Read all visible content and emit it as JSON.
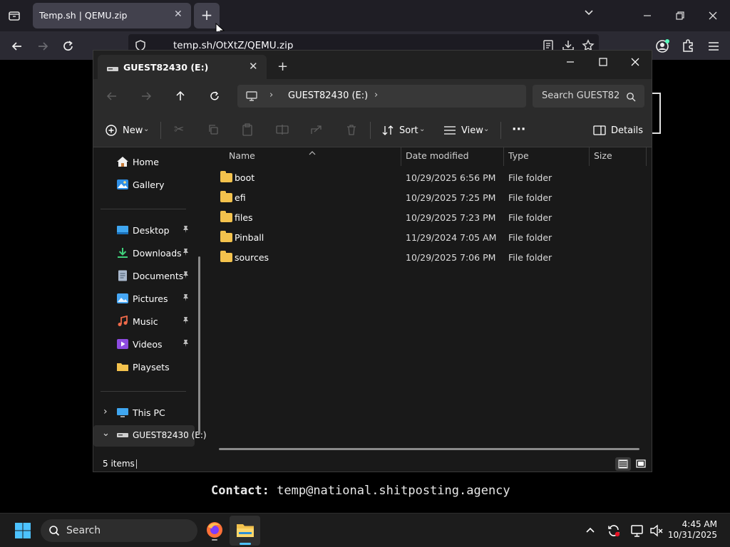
{
  "browser": {
    "tab_title": "Temp.sh | QEMU.zip",
    "tab_close": "✕",
    "new_tab": "+",
    "url": "temp.sh/OtXtZ/QEMU.zip",
    "icons": [
      "tab-list-icon",
      "back-icon",
      "forward-icon",
      "reload-icon",
      "shield-icon",
      "reader-view-icon",
      "download-icon",
      "bookmark-star-icon",
      "account-icon",
      "extensions-icon",
      "menu-icon",
      "chevron-down-icon"
    ]
  },
  "page": {
    "contact_label": "Contact:",
    "contact_value": "temp@national.shitposting.agency"
  },
  "explorer": {
    "tab_title": "GUEST82430 (E:)",
    "tab_close": "✕",
    "add_tab": "+",
    "breadcrumb": "GUEST82430 (E:)",
    "search_placeholder": "Search GUEST82",
    "cmd": {
      "new": "New",
      "sort": "Sort",
      "view": "View",
      "more": "···",
      "details": "Details"
    },
    "nav": {
      "quick": [
        {
          "label": "Home",
          "icon": "home-icon"
        },
        {
          "label": "Gallery",
          "icon": "gallery-icon"
        }
      ],
      "pinned": [
        {
          "label": "Desktop",
          "icon": "desktop-icon"
        },
        {
          "label": "Downloads",
          "icon": "downloads-icon"
        },
        {
          "label": "Documents",
          "icon": "documents-icon"
        },
        {
          "label": "Pictures",
          "icon": "pictures-icon"
        },
        {
          "label": "Music",
          "icon": "music-icon"
        },
        {
          "label": "Videos",
          "icon": "videos-icon"
        },
        {
          "label": "Playsets",
          "icon": "folder-icon"
        }
      ],
      "pin_glyph": "📌",
      "this_pc": "This PC",
      "drive": "GUEST82430 (E:)"
    },
    "columns": {
      "name": "Name",
      "date": "Date modified",
      "type": "Type",
      "size": "Size"
    },
    "files": [
      {
        "name": "boot",
        "date": "10/29/2025 6:56 PM",
        "type": "File folder"
      },
      {
        "name": "efi",
        "date": "10/29/2025 7:25 PM",
        "type": "File folder"
      },
      {
        "name": "files",
        "date": "10/29/2025 7:23 PM",
        "type": "File folder"
      },
      {
        "name": "Pinball",
        "date": "11/29/2024 7:05 AM",
        "type": "File folder"
      },
      {
        "name": "sources",
        "date": "10/29/2025 7:06 PM",
        "type": "File folder"
      }
    ],
    "status": "5 items"
  },
  "taskbar": {
    "search_label": "Search",
    "time": "4:45 AM",
    "date": "10/31/2025"
  },
  "colors": {
    "accent": "#0078d4",
    "folder": "#f3c24d",
    "firefox": "#ff7139"
  }
}
